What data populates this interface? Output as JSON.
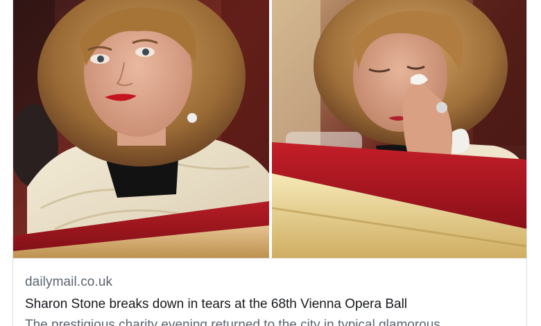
{
  "link_preview": {
    "images": [
      {
        "name": "photo-left",
        "alt": ""
      },
      {
        "name": "photo-right",
        "alt": ""
      }
    ],
    "source": "dailymail.co.uk",
    "headline": "Sharon Stone breaks down in tears at the 68th Vienna Opera Ball",
    "description": "The prestigious charity evening returned to the city in typical glamorous"
  }
}
